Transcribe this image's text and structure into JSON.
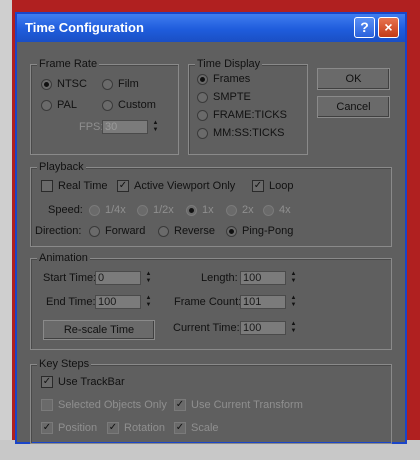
{
  "window": {
    "title": "Time Configuration",
    "help_icon": "?",
    "close_icon": "×"
  },
  "buttons": {
    "ok": "OK",
    "cancel": "Cancel"
  },
  "frame_rate": {
    "label": "Frame Rate",
    "options": [
      "NTSC",
      "Film",
      "PAL",
      "Custom"
    ],
    "selected": "NTSC",
    "fps_label": "FPS:",
    "fps_value": "30"
  },
  "time_display": {
    "label": "Time Display",
    "options": [
      "Frames",
      "SMPTE",
      "FRAME:TICKS",
      "MM:SS:TICKS"
    ],
    "selected": "Frames"
  },
  "playback": {
    "label": "Playback",
    "real_time": "Real Time",
    "active_viewport_only": "Active Viewport Only",
    "loop": "Loop",
    "speed_label": "Speed:",
    "speed_options": [
      "1/4x",
      "1/2x",
      "1x",
      "2x",
      "4x"
    ],
    "speed_selected": "1x",
    "direction_label": "Direction:",
    "direction_options": [
      "Forward",
      "Reverse",
      "Ping-Pong"
    ],
    "direction_selected": "Ping-Pong"
  },
  "animation": {
    "label": "Animation",
    "start_time_label": "Start Time:",
    "start_time": "0",
    "end_time_label": "End Time:",
    "end_time": "100",
    "length_label": "Length:",
    "length": "100",
    "frame_count_label": "Frame Count:",
    "frame_count": "101",
    "current_time_label": "Current Time:",
    "current_time": "100",
    "rescale_button": "Re-scale Time"
  },
  "key_steps": {
    "label": "Key Steps",
    "use_trackbar": "Use TrackBar",
    "selected_objects_only": "Selected Objects Only",
    "use_current_transform": "Use Current Transform",
    "position": "Position",
    "rotation": "Rotation",
    "scale": "Scale"
  },
  "colors": {
    "titlebar": "#1f5cdc",
    "dialog_bg": "#5f5f5f"
  }
}
